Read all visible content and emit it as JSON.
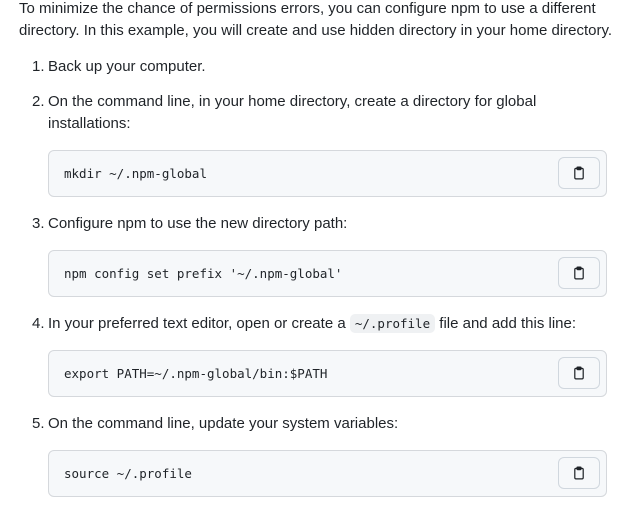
{
  "intro": "To minimize the chance of permissions errors, you can configure npm to use a different directory. In this example, you will create and use hidden directory in your home directory.",
  "steps": [
    {
      "num": "1.",
      "text": "Back up your computer."
    },
    {
      "num": "2.",
      "text": "On the command line, in your home directory, create a directory for global installations:",
      "code": "mkdir ~/.npm-global"
    },
    {
      "num": "3.",
      "text": "Configure npm to use the new directory path:",
      "code": "npm config set prefix '~/.npm-global'"
    },
    {
      "num": "4.",
      "text_before": "In your preferred text editor, open or create a",
      "inline_code": "~/.profile",
      "text_after": "file and add this line:",
      "code": "export PATH=~/.npm-global/bin:$PATH"
    },
    {
      "num": "5.",
      "text": "On the command line, update your system variables:",
      "code": "source ~/.profile"
    }
  ],
  "icons": {
    "copy": "clipboard-icon"
  }
}
